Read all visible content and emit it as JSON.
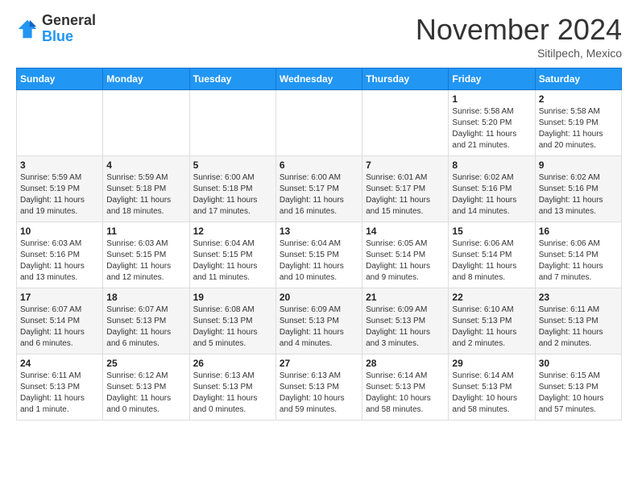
{
  "header": {
    "logo_general": "General",
    "logo_blue": "Blue",
    "month": "November 2024",
    "location": "Sitilpech, Mexico"
  },
  "weekdays": [
    "Sunday",
    "Monday",
    "Tuesday",
    "Wednesday",
    "Thursday",
    "Friday",
    "Saturday"
  ],
  "rows": [
    {
      "cells": [
        {
          "day": "",
          "info": ""
        },
        {
          "day": "",
          "info": ""
        },
        {
          "day": "",
          "info": ""
        },
        {
          "day": "",
          "info": ""
        },
        {
          "day": "",
          "info": ""
        },
        {
          "day": "1",
          "info": "Sunrise: 5:58 AM\nSunset: 5:20 PM\nDaylight: 11 hours\nand 21 minutes."
        },
        {
          "day": "2",
          "info": "Sunrise: 5:58 AM\nSunset: 5:19 PM\nDaylight: 11 hours\nand 20 minutes."
        }
      ]
    },
    {
      "cells": [
        {
          "day": "3",
          "info": "Sunrise: 5:59 AM\nSunset: 5:19 PM\nDaylight: 11 hours\nand 19 minutes."
        },
        {
          "day": "4",
          "info": "Sunrise: 5:59 AM\nSunset: 5:18 PM\nDaylight: 11 hours\nand 18 minutes."
        },
        {
          "day": "5",
          "info": "Sunrise: 6:00 AM\nSunset: 5:18 PM\nDaylight: 11 hours\nand 17 minutes."
        },
        {
          "day": "6",
          "info": "Sunrise: 6:00 AM\nSunset: 5:17 PM\nDaylight: 11 hours\nand 16 minutes."
        },
        {
          "day": "7",
          "info": "Sunrise: 6:01 AM\nSunset: 5:17 PM\nDaylight: 11 hours\nand 15 minutes."
        },
        {
          "day": "8",
          "info": "Sunrise: 6:02 AM\nSunset: 5:16 PM\nDaylight: 11 hours\nand 14 minutes."
        },
        {
          "day": "9",
          "info": "Sunrise: 6:02 AM\nSunset: 5:16 PM\nDaylight: 11 hours\nand 13 minutes."
        }
      ]
    },
    {
      "cells": [
        {
          "day": "10",
          "info": "Sunrise: 6:03 AM\nSunset: 5:16 PM\nDaylight: 11 hours\nand 13 minutes."
        },
        {
          "day": "11",
          "info": "Sunrise: 6:03 AM\nSunset: 5:15 PM\nDaylight: 11 hours\nand 12 minutes."
        },
        {
          "day": "12",
          "info": "Sunrise: 6:04 AM\nSunset: 5:15 PM\nDaylight: 11 hours\nand 11 minutes."
        },
        {
          "day": "13",
          "info": "Sunrise: 6:04 AM\nSunset: 5:15 PM\nDaylight: 11 hours\nand 10 minutes."
        },
        {
          "day": "14",
          "info": "Sunrise: 6:05 AM\nSunset: 5:14 PM\nDaylight: 11 hours\nand 9 minutes."
        },
        {
          "day": "15",
          "info": "Sunrise: 6:06 AM\nSunset: 5:14 PM\nDaylight: 11 hours\nand 8 minutes."
        },
        {
          "day": "16",
          "info": "Sunrise: 6:06 AM\nSunset: 5:14 PM\nDaylight: 11 hours\nand 7 minutes."
        }
      ]
    },
    {
      "cells": [
        {
          "day": "17",
          "info": "Sunrise: 6:07 AM\nSunset: 5:14 PM\nDaylight: 11 hours\nand 6 minutes."
        },
        {
          "day": "18",
          "info": "Sunrise: 6:07 AM\nSunset: 5:13 PM\nDaylight: 11 hours\nand 6 minutes."
        },
        {
          "day": "19",
          "info": "Sunrise: 6:08 AM\nSunset: 5:13 PM\nDaylight: 11 hours\nand 5 minutes."
        },
        {
          "day": "20",
          "info": "Sunrise: 6:09 AM\nSunset: 5:13 PM\nDaylight: 11 hours\nand 4 minutes."
        },
        {
          "day": "21",
          "info": "Sunrise: 6:09 AM\nSunset: 5:13 PM\nDaylight: 11 hours\nand 3 minutes."
        },
        {
          "day": "22",
          "info": "Sunrise: 6:10 AM\nSunset: 5:13 PM\nDaylight: 11 hours\nand 2 minutes."
        },
        {
          "day": "23",
          "info": "Sunrise: 6:11 AM\nSunset: 5:13 PM\nDaylight: 11 hours\nand 2 minutes."
        }
      ]
    },
    {
      "cells": [
        {
          "day": "24",
          "info": "Sunrise: 6:11 AM\nSunset: 5:13 PM\nDaylight: 11 hours\nand 1 minute."
        },
        {
          "day": "25",
          "info": "Sunrise: 6:12 AM\nSunset: 5:13 PM\nDaylight: 11 hours\nand 0 minutes."
        },
        {
          "day": "26",
          "info": "Sunrise: 6:13 AM\nSunset: 5:13 PM\nDaylight: 11 hours\nand 0 minutes."
        },
        {
          "day": "27",
          "info": "Sunrise: 6:13 AM\nSunset: 5:13 PM\nDaylight: 10 hours\nand 59 minutes."
        },
        {
          "day": "28",
          "info": "Sunrise: 6:14 AM\nSunset: 5:13 PM\nDaylight: 10 hours\nand 58 minutes."
        },
        {
          "day": "29",
          "info": "Sunrise: 6:14 AM\nSunset: 5:13 PM\nDaylight: 10 hours\nand 58 minutes."
        },
        {
          "day": "30",
          "info": "Sunrise: 6:15 AM\nSunset: 5:13 PM\nDaylight: 10 hours\nand 57 minutes."
        }
      ]
    }
  ]
}
